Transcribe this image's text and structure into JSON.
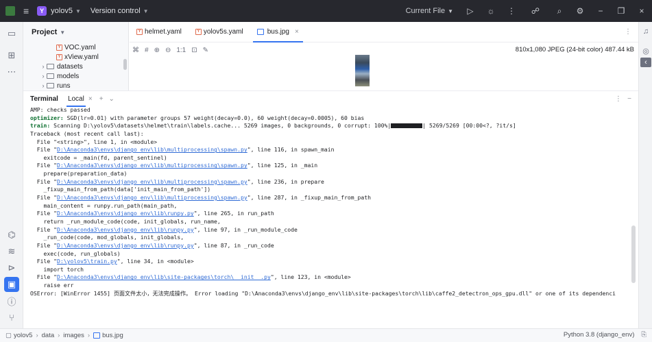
{
  "titlebar": {
    "project_badge": "Y",
    "project_name": "yolov5",
    "vcs": "Version control",
    "run_config": "Current File"
  },
  "project_panel": {
    "title": "Project",
    "items": [
      {
        "label": "VOC.yaml",
        "kind": "yaml"
      },
      {
        "label": "xView.yaml",
        "kind": "yaml"
      },
      {
        "label": "datasets",
        "kind": "folder"
      },
      {
        "label": "models",
        "kind": "folder"
      },
      {
        "label": "runs",
        "kind": "folder"
      }
    ]
  },
  "editor": {
    "tabs": [
      {
        "label": "helmet.yaml",
        "icon": "yaml-icon"
      },
      {
        "label": "yolov5s.yaml",
        "icon": "yaml-icon"
      },
      {
        "label": "bus.jpg",
        "icon": "image-icon",
        "active": true
      }
    ],
    "zoom_label": "1:1",
    "image_info": "810x1,080 JPEG (24-bit color) 487.44 kB"
  },
  "terminal": {
    "title": "Terminal",
    "tab": "Local",
    "lines": [
      {
        "parts": [
          {
            "t": "AMP: checks passed"
          }
        ]
      },
      {
        "parts": [
          {
            "t": "optimizer:",
            "c": "kw"
          },
          {
            "t": " SGD(lr=0.01) with parameter groups 57 weight(decay=0.0), 60 weight(decay=0.0005), 60 bias"
          }
        ]
      },
      {
        "parts": [
          {
            "t": "train:",
            "c": "kw"
          },
          {
            "t": " Scanning D:\\yolov5\\datasets\\helmet\\train\\labels.cache... 5269 images, 0 backgrounds, 0 corrupt: 100%|"
          },
          {
            "t": "",
            "c": "prog"
          },
          {
            "t": "| 5269/5269 [00:00<?, ?it/s]"
          }
        ]
      },
      {
        "parts": [
          {
            "t": "Traceback (most recent call last):"
          }
        ]
      },
      {
        "parts": [
          {
            "t": "  File \"<string>\", line 1, in <module>"
          }
        ]
      },
      {
        "parts": [
          {
            "t": "  File \""
          },
          {
            "t": "D:\\Anaconda3\\envs\\django_env\\lib\\multiprocessing\\spawn.py",
            "c": "lnk"
          },
          {
            "t": "\", line 116, in spawn_main"
          }
        ]
      },
      {
        "parts": [
          {
            "t": "    exitcode = _main(fd, parent_sentinel)"
          }
        ]
      },
      {
        "parts": [
          {
            "t": "  File \""
          },
          {
            "t": "D:\\Anaconda3\\envs\\django_env\\lib\\multiprocessing\\spawn.py",
            "c": "lnk"
          },
          {
            "t": "\", line 125, in _main"
          }
        ]
      },
      {
        "parts": [
          {
            "t": "    prepare(preparation_data)"
          }
        ]
      },
      {
        "parts": [
          {
            "t": "  File \""
          },
          {
            "t": "D:\\Anaconda3\\envs\\django_env\\lib\\multiprocessing\\spawn.py",
            "c": "lnk"
          },
          {
            "t": "\", line 236, in prepare"
          }
        ]
      },
      {
        "parts": [
          {
            "t": "    _fixup_main_from_path(data['init_main_from_path'])"
          }
        ]
      },
      {
        "parts": [
          {
            "t": "  File \""
          },
          {
            "t": "D:\\Anaconda3\\envs\\django_env\\lib\\multiprocessing\\spawn.py",
            "c": "lnk"
          },
          {
            "t": "\", line 287, in _fixup_main_from_path"
          }
        ]
      },
      {
        "parts": [
          {
            "t": "    main_content = runpy.run_path(main_path,"
          }
        ]
      },
      {
        "parts": [
          {
            "t": "  File \""
          },
          {
            "t": "D:\\Anaconda3\\envs\\django_env\\lib\\runpy.py",
            "c": "lnk"
          },
          {
            "t": "\", line 265, in run_path"
          }
        ]
      },
      {
        "parts": [
          {
            "t": "    return _run_module_code(code, init_globals, run_name,"
          }
        ]
      },
      {
        "parts": [
          {
            "t": "  File \""
          },
          {
            "t": "D:\\Anaconda3\\envs\\django_env\\lib\\runpy.py",
            "c": "lnk"
          },
          {
            "t": "\", line 97, in _run_module_code"
          }
        ]
      },
      {
        "parts": [
          {
            "t": "    _run_code(code, mod_globals, init_globals,"
          }
        ]
      },
      {
        "parts": [
          {
            "t": "  File \""
          },
          {
            "t": "D:\\Anaconda3\\envs\\django_env\\lib\\runpy.py",
            "c": "lnk"
          },
          {
            "t": "\", line 87, in _run_code"
          }
        ]
      },
      {
        "parts": [
          {
            "t": "    exec(code, run_globals)"
          }
        ]
      },
      {
        "parts": [
          {
            "t": "  File \""
          },
          {
            "t": "D:\\yolov5\\train.py",
            "c": "lnk"
          },
          {
            "t": "\", line 34, in <module>"
          }
        ]
      },
      {
        "parts": [
          {
            "t": "    import torch"
          }
        ]
      },
      {
        "parts": [
          {
            "t": "  File \""
          },
          {
            "t": "D:\\Anaconda3\\envs\\django_env\\lib\\site-packages\\torch\\__init__.py",
            "c": "lnk"
          },
          {
            "t": "\", line 123, in <module>"
          }
        ]
      },
      {
        "parts": [
          {
            "t": "    raise err"
          }
        ]
      },
      {
        "parts": [
          {
            "t": "OSError: [WinError 1455] 页面文件太小，无法完成操作。 Error loading \"D:\\Anaconda3\\envs\\django_env\\lib\\site-packages\\torch\\lib\\caffe2_detectron_ops_gpu.dll\" or one of its dependenci"
          }
        ]
      }
    ]
  },
  "statusbar": {
    "breadcrumb": [
      "yolov5",
      "data",
      "images",
      "bus.jpg"
    ],
    "interpreter": "Python 3.8 (django_env)"
  }
}
